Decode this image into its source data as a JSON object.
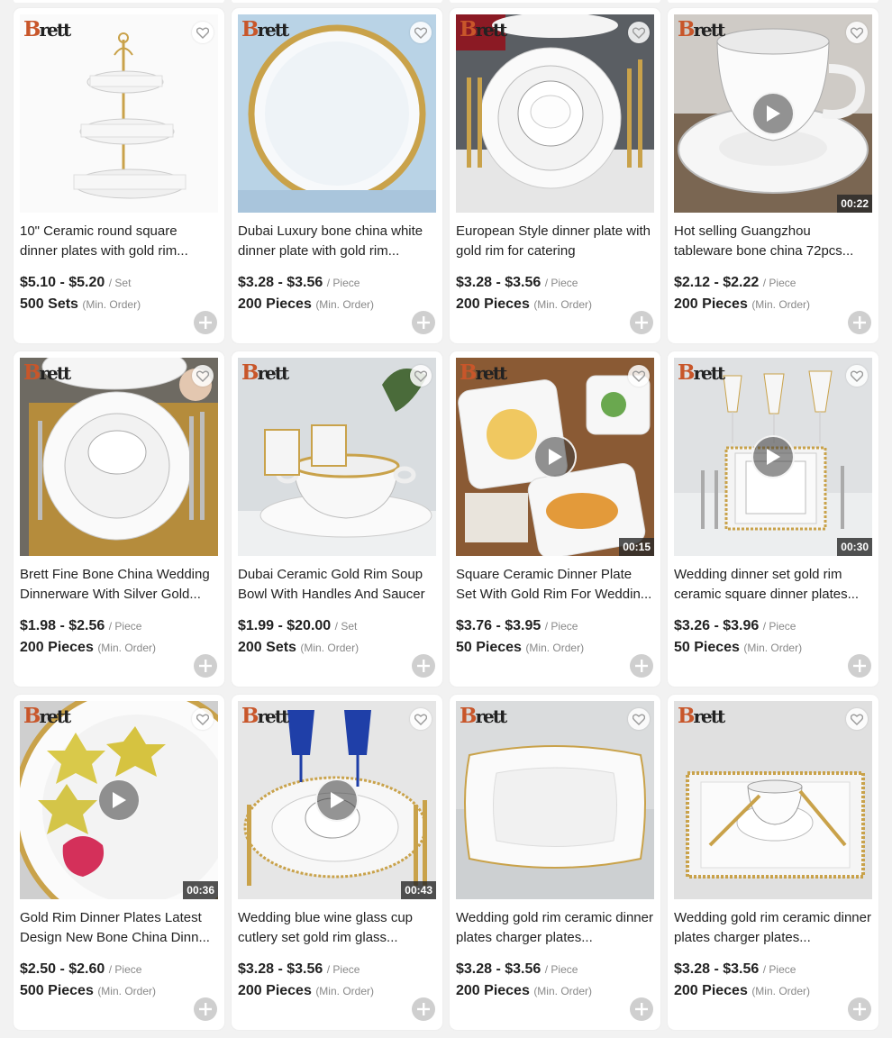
{
  "brand_logo": "Brett",
  "min_order_note": "(Min. Order)",
  "products": [
    {
      "title": "10\" Ceramic round square dinner plates with gold rim...",
      "price": "$5.10 - $5.20",
      "unit": "/ Set",
      "moq": "500 Sets",
      "video": false,
      "duration": "",
      "image": "tiered-stand"
    },
    {
      "title": "Dubai Luxury bone china white dinner plate with gold rim...",
      "price": "$3.28 - $3.56",
      "unit": "/ Piece",
      "moq": "200 Pieces",
      "video": false,
      "duration": "",
      "image": "gold-rim-plate"
    },
    {
      "title": "European Style dinner plate with gold rim for catering",
      "price": "$3.28 - $3.56",
      "unit": "/ Piece",
      "moq": "200 Pieces",
      "video": false,
      "duration": "",
      "image": "table-setting-gold-cutlery"
    },
    {
      "title": "Hot selling Guangzhou tableware bone china 72pcs...",
      "price": "$2.12 - $2.22",
      "unit": "/ Piece",
      "moq": "200 Pieces",
      "video": true,
      "duration": "00:22",
      "image": "cup-saucer"
    },
    {
      "title": "Brett Fine Bone China Wedding Dinnerware With Silver Gold...",
      "price": "$1.98 - $2.56",
      "unit": "/ Piece",
      "moq": "200 Pieces",
      "video": false,
      "duration": "",
      "image": "plates-gold-mat"
    },
    {
      "title": "Dubai Ceramic Gold Rim Soup Bowl With Handles And Saucer",
      "price": "$1.99 - $20.00",
      "unit": "/ Set",
      "moq": "200 Sets",
      "video": false,
      "duration": "",
      "image": "soup-bowl"
    },
    {
      "title": "Square Ceramic Dinner Plate Set With Gold Rim For Weddin...",
      "price": "$3.76 - $3.95",
      "unit": "/ Piece",
      "moq": "50 Pieces",
      "video": true,
      "duration": "00:15",
      "image": "square-plates-food"
    },
    {
      "title": "Wedding dinner set gold rim ceramic square dinner plates...",
      "price": "$3.26 - $3.96",
      "unit": "/ Piece",
      "moq": "50 Pieces",
      "video": true,
      "duration": "00:30",
      "image": "square-set-glasses"
    },
    {
      "title": "Gold Rim Dinner Plates Latest Design New Bone China Dinn...",
      "price": "$2.50 - $2.60",
      "unit": "/ Piece",
      "moq": "500 Pieces",
      "video": true,
      "duration": "00:36",
      "image": "plate-fruit"
    },
    {
      "title": "Wedding blue wine glass cup cutlery set gold rim glass...",
      "price": "$3.28 - $3.56",
      "unit": "/ Piece",
      "moq": "200 Pieces",
      "video": true,
      "duration": "00:43",
      "image": "blue-glasses"
    },
    {
      "title": "Wedding gold rim ceramic dinner plates charger plates...",
      "price": "$3.28 - $3.56",
      "unit": "/ Piece",
      "moq": "200 Pieces",
      "video": false,
      "duration": "",
      "image": "square-deep-plate"
    },
    {
      "title": "Wedding gold rim ceramic dinner plates charger plates...",
      "price": "$3.28 - $3.56",
      "unit": "/ Piece",
      "moq": "200 Pieces",
      "video": false,
      "duration": "",
      "image": "bead-charger-cup"
    }
  ],
  "colors": {
    "logo_accent": "#c8562a",
    "gold": "#c9a24a",
    "add_button": "#cfcfcf"
  }
}
